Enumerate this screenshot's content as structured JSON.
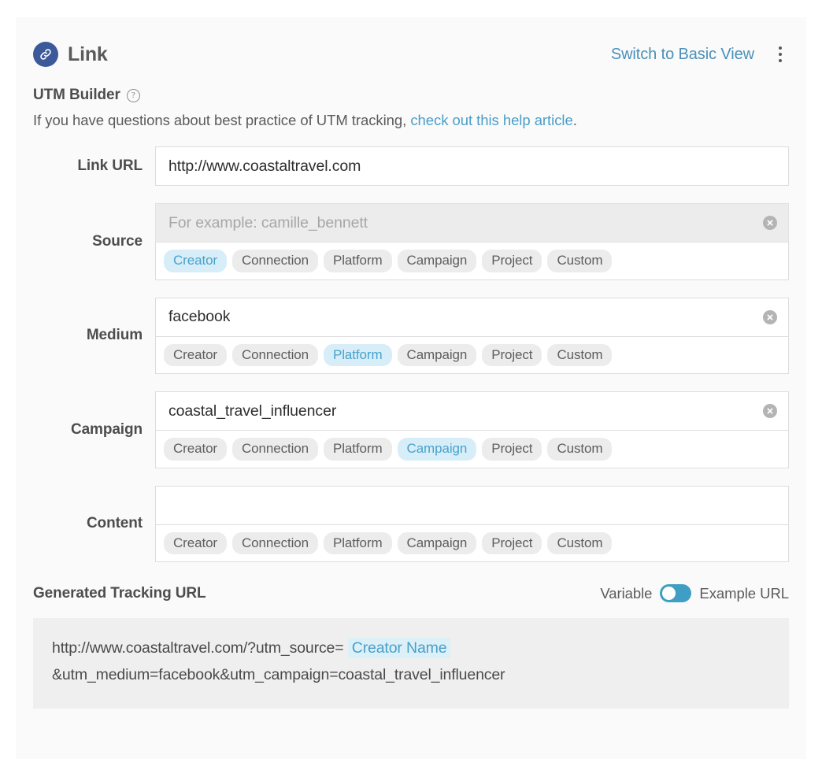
{
  "header": {
    "icon": "link-chain-icon",
    "title": "Link",
    "switch_view_label": "Switch to Basic View",
    "menu_icon": "kebab-menu-icon",
    "badge_color": "#3c5a9a",
    "link_color": "#4a90b8"
  },
  "builder": {
    "heading": "UTM Builder",
    "help_icon": "question-mark-icon",
    "description_prefix": "If you have questions about best practice of UTM tracking, ",
    "description_link": "check out this help article",
    "description_suffix": "."
  },
  "chip_options": [
    "Creator",
    "Connection",
    "Platform",
    "Campaign",
    "Project",
    "Custom"
  ],
  "fields": [
    {
      "label": "Link URL",
      "value": "http://www.coastaltravel.com",
      "placeholder": "",
      "disabled": false,
      "has_clear": false,
      "has_chips": false,
      "selected_chip": null
    },
    {
      "label": "Source",
      "value": "",
      "placeholder": "For example: camille_bennett",
      "disabled": true,
      "has_clear": true,
      "has_chips": true,
      "selected_chip": "Creator"
    },
    {
      "label": "Medium",
      "value": "facebook",
      "placeholder": "",
      "disabled": false,
      "has_clear": true,
      "has_chips": true,
      "selected_chip": "Platform"
    },
    {
      "label": "Campaign",
      "value": "coastal_travel_influencer",
      "placeholder": "",
      "disabled": false,
      "has_clear": true,
      "has_chips": true,
      "selected_chip": "Campaign"
    },
    {
      "label": "Content",
      "value": "",
      "placeholder": "",
      "disabled": false,
      "has_clear": false,
      "has_chips": true,
      "selected_chip": null
    }
  ],
  "generated": {
    "title": "Generated Tracking URL",
    "toggle_left_label": "Variable",
    "toggle_right_label": "Example URL",
    "toggle_state": "variable",
    "toggle_color": "#3f9ec4",
    "url_part_1": "http://www.coastaltravel.com/?utm_source=",
    "url_token": "Creator Name",
    "url_part_2": "&utm_medium=facebook&utm_campaign=coastal_travel_influencer"
  }
}
